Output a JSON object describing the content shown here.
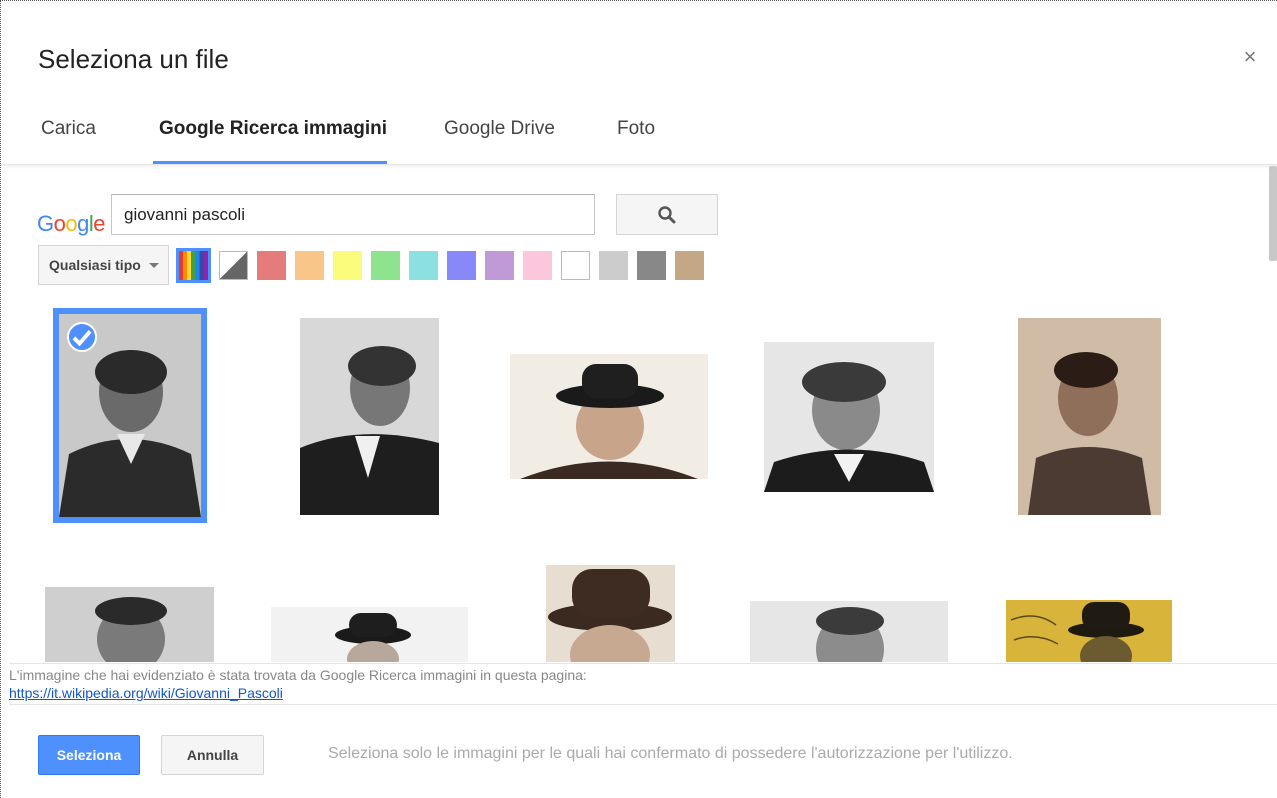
{
  "dialog": {
    "title": "Seleziona un file",
    "close_label": "×"
  },
  "tabs": [
    {
      "label": "Carica",
      "active": false
    },
    {
      "label": "Google Ricerca immagini",
      "active": true
    },
    {
      "label": "Google Drive",
      "active": false
    },
    {
      "label": "Foto",
      "active": false
    }
  ],
  "search": {
    "logo": [
      "G",
      "o",
      "o",
      "g",
      "l",
      "e"
    ],
    "logo_colors": [
      "#4285f4",
      "#ea4335",
      "#fbbc05",
      "#4285f4",
      "#34a853",
      "#ea4335"
    ],
    "value": "giovanni pascoli",
    "button_icon": "search-icon"
  },
  "filters": {
    "type_label": "Qualsiasi tipo",
    "selected_color": "any-color",
    "colors": [
      "any-color",
      "black-white",
      "#e57c7c",
      "#f9c68a",
      "#fcfc7c",
      "#8ee48e",
      "#8ce0e0",
      "#8888f8",
      "#c09ad6",
      "#fcc6dc",
      "#ffffff",
      "#cccccc",
      "#888888",
      "#c4a886"
    ]
  },
  "images": {
    "selected_index": 0,
    "count": 10
  },
  "source": {
    "text": "L'immagine che hai evidenziato è stata trovata da Google Ricerca immagini in questa pagina:",
    "link": "https://it.wikipedia.org/wiki/Giovanni_Pascoli"
  },
  "footer": {
    "select_label": "Seleziona",
    "cancel_label": "Annulla",
    "note": "Seleziona solo le immagini per le quali hai confermato di possedere l'autorizzazione per l'utilizzo."
  },
  "accent_color": "#4d90fe"
}
